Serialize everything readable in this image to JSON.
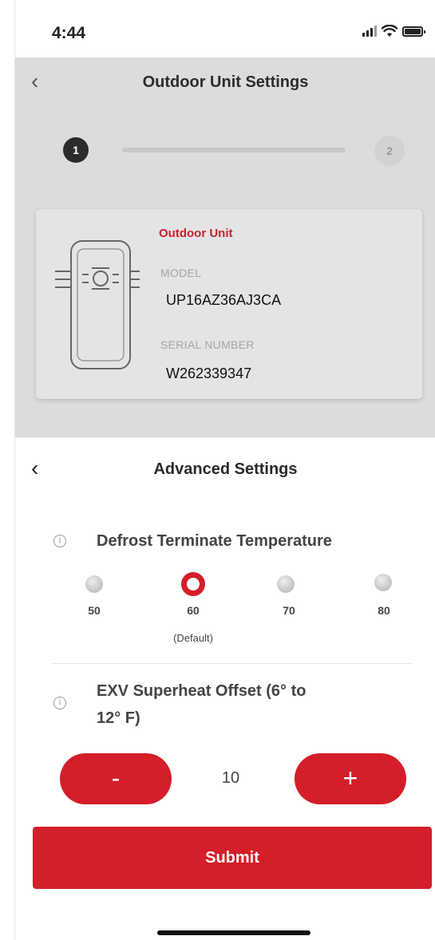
{
  "status_bar": {
    "time": "4:44"
  },
  "background_page": {
    "title": "Outdoor Unit Settings",
    "stepper": {
      "step1": "1",
      "step2": "2",
      "current_step": 1
    },
    "unit_card": {
      "type_label": "Outdoor Unit",
      "model_label": "MODEL",
      "model_value": "UP16AZ36AJ3CA",
      "serial_label": "SERIAL NUMBER",
      "serial_value": "W262339347"
    }
  },
  "sheet": {
    "title": "Advanced Settings",
    "defrost": {
      "title": "Defrost Terminate Temperature",
      "options": [
        "50",
        "60",
        "70",
        "80"
      ],
      "selected": "60",
      "default_note": "(Default)"
    },
    "exv": {
      "title_line1": "EXV Superheat Offset (6° to",
      "title_line2": "12° F)",
      "value": "10",
      "minus_label": "-",
      "plus_label": "+"
    },
    "submit_label": "Submit"
  },
  "colors": {
    "accent": "#d41e2a",
    "unit_label": "#c42230"
  }
}
